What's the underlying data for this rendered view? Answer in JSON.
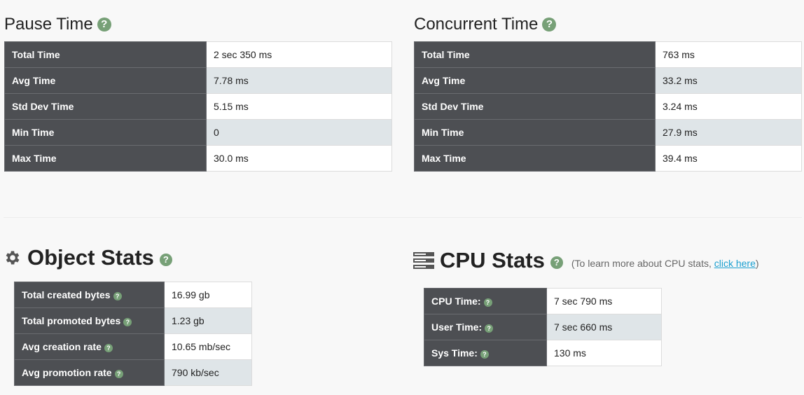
{
  "pause": {
    "title": "Pause Time",
    "rows": [
      {
        "label": "Total Time",
        "value": "2 sec 350 ms"
      },
      {
        "label": "Avg Time",
        "value": "7.78 ms"
      },
      {
        "label": "Std Dev Time",
        "value": "5.15 ms"
      },
      {
        "label": "Min Time",
        "value": "0"
      },
      {
        "label": "Max Time",
        "value": "30.0 ms"
      }
    ]
  },
  "concurrent": {
    "title": "Concurrent Time",
    "rows": [
      {
        "label": "Total Time",
        "value": "763 ms"
      },
      {
        "label": "Avg Time",
        "value": "33.2 ms"
      },
      {
        "label": "Std Dev Time",
        "value": "3.24 ms"
      },
      {
        "label": "Min Time",
        "value": "27.9 ms"
      },
      {
        "label": "Max Time",
        "value": "39.4 ms"
      }
    ]
  },
  "object_stats": {
    "title": "Object Stats",
    "icon": "gear-icon",
    "rows": [
      {
        "label": "Total created bytes",
        "value": "16.99 gb"
      },
      {
        "label": "Total promoted bytes",
        "value": "1.23 gb"
      },
      {
        "label": "Avg creation rate",
        "value": "10.65 mb/sec"
      },
      {
        "label": "Avg promotion rate",
        "value": "790 kb/sec"
      }
    ]
  },
  "cpu_stats": {
    "title": "CPU Stats",
    "icon": "server-icon",
    "note_prefix": "(To learn more about CPU stats, ",
    "note_link": "click here",
    "note_suffix": ")",
    "rows": [
      {
        "label": "CPU Time:",
        "value": "7 sec 790 ms"
      },
      {
        "label": "User Time:",
        "value": "7 sec 660 ms"
      },
      {
        "label": "Sys Time:",
        "value": "130 ms"
      }
    ]
  },
  "help_glyph": "?",
  "colors": {
    "key_bg": "#4d4f53",
    "alt_row_bg": "#dfe5e8",
    "help_icon": "#77a077",
    "link": "#1a9fd0"
  }
}
